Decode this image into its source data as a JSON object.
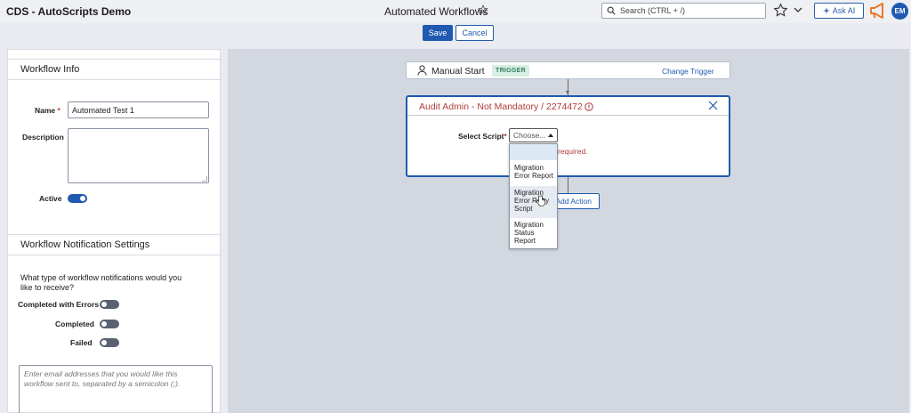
{
  "header": {
    "app_title": "CDS - AutoScripts Demo",
    "page_title": "Automated Workflows",
    "search_placeholder": "Search (CTRL + /)",
    "ask_ai_label": "Ask AI",
    "avatar_initials": "EM"
  },
  "toolbar": {
    "save_label": "Save",
    "cancel_label": "Cancel"
  },
  "workflow_info": {
    "heading": "Workflow Info",
    "name_label": "Name",
    "name_required_mark": "*",
    "name_value": "Automated Test 1",
    "description_label": "Description",
    "description_value": "",
    "active_label": "Active",
    "active": true
  },
  "notifications": {
    "heading": "Workflow Notification Settings",
    "question": "What type of workflow notifications would you like to receive?",
    "options": [
      {
        "label": "Completed with Errors",
        "enabled": false
      },
      {
        "label": "Completed",
        "enabled": false
      },
      {
        "label": "Failed",
        "enabled": false
      }
    ],
    "email_placeholder": "Enter email addresses that you would like this workflow sent to, separated by a semicolon (;)."
  },
  "canvas": {
    "trigger": {
      "title": "Manual Start",
      "badge": "TRIGGER",
      "change_label": "Change Trigger"
    },
    "action": {
      "title": "Audit Admin - Not Mandatory / 2274472",
      "select_label": "Select Script",
      "select_required_mark": "*",
      "select_placeholder": "Choose...",
      "error_text": "required.",
      "dropdown_options": [
        "Migration Error Report",
        "Migration Error Retry Script",
        "Migration Status Report"
      ]
    },
    "add_action_label": "Add Action"
  },
  "colors": {
    "primary": "#1f5ab0",
    "error": "#b03a3a",
    "trigger_badge_bg": "#d9efe4",
    "megaphone": "#e8792b"
  }
}
